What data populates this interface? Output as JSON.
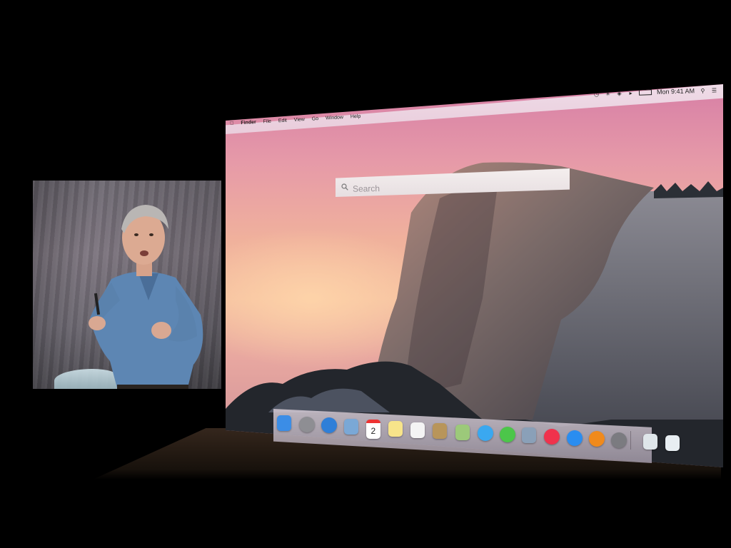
{
  "menubar": {
    "app_name": "Finder",
    "menus": [
      "File",
      "Edit",
      "View",
      "Go",
      "Window",
      "Help"
    ],
    "clock": "Mon 9:41 AM",
    "status_icons": [
      "time-machine-icon",
      "bluetooth-icon",
      "wifi-icon",
      "volume-icon",
      "battery-icon",
      "spotlight-icon",
      "notification-center-icon"
    ]
  },
  "spotlight": {
    "placeholder": "Search"
  },
  "dock": {
    "calendar_day": "2",
    "apps": [
      {
        "name": "finder",
        "color": "#3b8de6"
      },
      {
        "name": "launchpad",
        "color": "#8e8e93"
      },
      {
        "name": "safari",
        "color": "#2f7fd8"
      },
      {
        "name": "mail",
        "color": "#7aa8d6"
      },
      {
        "name": "calendar",
        "color": "#ffffff"
      },
      {
        "name": "notes",
        "color": "#f7e48a"
      },
      {
        "name": "reminders",
        "color": "#f4f4f4"
      },
      {
        "name": "contacts",
        "color": "#b8955a"
      },
      {
        "name": "maps",
        "color": "#9cc97a"
      },
      {
        "name": "messages",
        "color": "#3aa8f0"
      },
      {
        "name": "facetime",
        "color": "#4cc64a"
      },
      {
        "name": "photos",
        "color": "#8aa0b8"
      },
      {
        "name": "itunes",
        "color": "#f0324c"
      },
      {
        "name": "app-store",
        "color": "#2a8df0"
      },
      {
        "name": "ibooks",
        "color": "#f08a1c"
      },
      {
        "name": "system-preferences",
        "color": "#7b7b80"
      },
      {
        "name": "preview",
        "color": "#dfe6ea"
      },
      {
        "name": "trash",
        "color": "#e8eef2"
      }
    ]
  }
}
